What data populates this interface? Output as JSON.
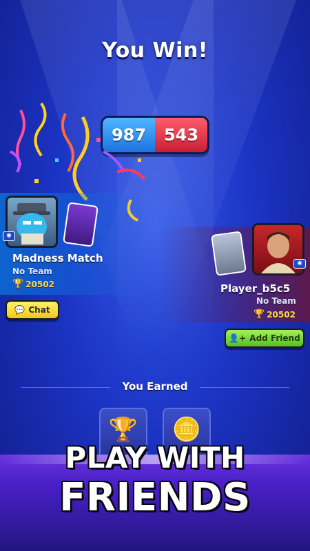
{
  "result": {
    "title": "You Win!"
  },
  "score": {
    "blue": "987",
    "red": "543"
  },
  "player_left": {
    "name": "Madness Match",
    "team": "No Team",
    "trophies": "20502",
    "chat_label": "Chat"
  },
  "player_right": {
    "name": "Player_b5c5",
    "team": "No Team",
    "trophies": "20502",
    "add_friend_label": "Add Friend"
  },
  "earned": {
    "label": "You Earned"
  },
  "promo": {
    "line1": "PLAY WITH",
    "line2": "FRIENDS"
  },
  "icons": {
    "trophy": "trophy-icon",
    "chat": "chat-bubble-icon",
    "add_friend": "add-friend-icon",
    "coin": "lightning-coin-icon"
  },
  "colors": {
    "background": "#1c34c4",
    "score_blue": "#1d73e0",
    "score_red": "#c91f33",
    "chat_button": "#f2c51d",
    "add_friend_button": "#55c020",
    "trophy_text": "#ffd84a"
  }
}
